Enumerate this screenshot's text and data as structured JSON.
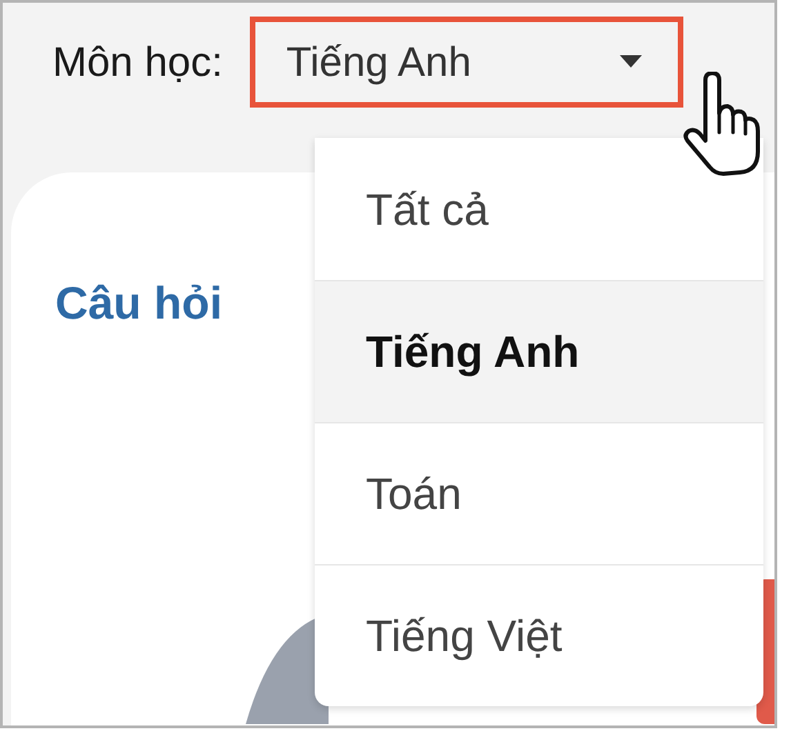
{
  "subject_filter": {
    "label": "Môn học:",
    "value": "Tiếng Anh",
    "open": true
  },
  "dropdown_options": [
    {
      "label": "Tất cả",
      "selected": false
    },
    {
      "label": "Tiếng Anh",
      "selected": true
    },
    {
      "label": "Toán",
      "selected": false
    },
    {
      "label": "Tiếng Việt",
      "selected": false
    }
  ],
  "card": {
    "title": "Câu hỏi"
  }
}
